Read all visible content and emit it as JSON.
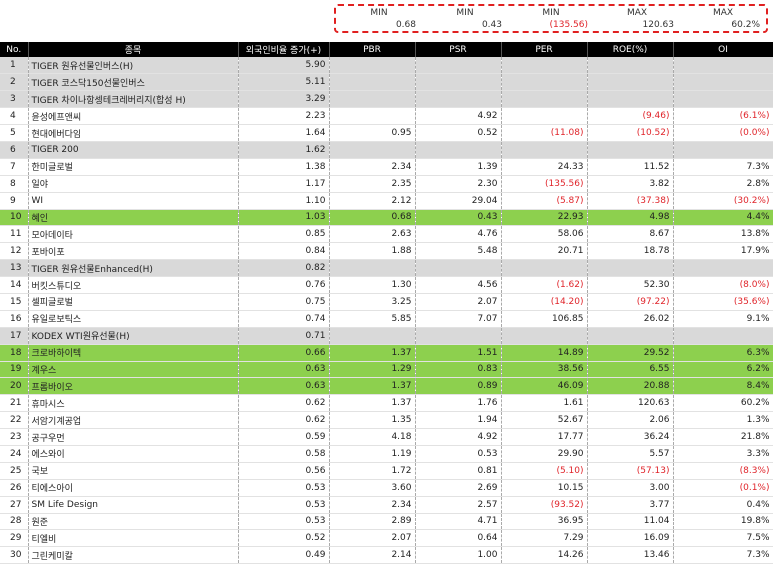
{
  "summary": [
    {
      "label": "MIN",
      "value": "0.68",
      "negative": false
    },
    {
      "label": "MIN",
      "value": "0.43",
      "negative": false
    },
    {
      "label": "MIN",
      "value": "(135.56)",
      "negative": true
    },
    {
      "label": "MAX",
      "value": "120.63",
      "negative": false
    },
    {
      "label": "MAX",
      "value": "60.2%",
      "negative": false
    }
  ],
  "columns": [
    "No.",
    "종목",
    "외국인비율 증가(+)",
    "PBR",
    "PSR",
    "PER",
    "ROE(%)",
    "OI"
  ],
  "rows": [
    {
      "no": "1",
      "name": "TIGER 원유선물인버스(H)",
      "foreign": "5.90",
      "pbr": "",
      "psr": "",
      "per": "",
      "roe": "",
      "oi": "",
      "style": "gray"
    },
    {
      "no": "2",
      "name": "TIGER 코스닥150선물인버스",
      "foreign": "5.11",
      "pbr": "",
      "psr": "",
      "per": "",
      "roe": "",
      "oi": "",
      "style": "gray"
    },
    {
      "no": "3",
      "name": "TIGER 차이나항셍테크레버리지(합성 H)",
      "foreign": "3.29",
      "pbr": "",
      "psr": "",
      "per": "",
      "roe": "",
      "oi": "",
      "style": "gray"
    },
    {
      "no": "4",
      "name": "윤성에프앤씨",
      "foreign": "2.23",
      "pbr": "",
      "psr": "4.92",
      "per": "",
      "roe": "(9.46)",
      "oi": "(6.1%)",
      "style": ""
    },
    {
      "no": "5",
      "name": "현대에버다임",
      "foreign": "1.64",
      "pbr": "0.95",
      "psr": "0.52",
      "per": "(11.08)",
      "roe": "(10.52)",
      "oi": "(0.0%)",
      "style": ""
    },
    {
      "no": "6",
      "name": "TIGER 200",
      "foreign": "1.62",
      "pbr": "",
      "psr": "",
      "per": "",
      "roe": "",
      "oi": "",
      "style": "gray"
    },
    {
      "no": "7",
      "name": "한미글로벌",
      "foreign": "1.38",
      "pbr": "2.34",
      "psr": "1.39",
      "per": "24.33",
      "roe": "11.52",
      "oi": "7.3%",
      "style": ""
    },
    {
      "no": "8",
      "name": "일야",
      "foreign": "1.17",
      "pbr": "2.35",
      "psr": "2.30",
      "per": "(135.56)",
      "roe": "3.82",
      "oi": "2.8%",
      "style": ""
    },
    {
      "no": "9",
      "name": "WI",
      "foreign": "1.10",
      "pbr": "2.12",
      "psr": "29.04",
      "per": "(5.87)",
      "roe": "(37.38)",
      "oi": "(30.2%)",
      "style": ""
    },
    {
      "no": "10",
      "name": "혜인",
      "foreign": "1.03",
      "pbr": "0.68",
      "psr": "0.43",
      "per": "22.93",
      "roe": "4.98",
      "oi": "4.4%",
      "style": "green"
    },
    {
      "no": "11",
      "name": "모아데이타",
      "foreign": "0.85",
      "pbr": "2.63",
      "psr": "4.76",
      "per": "58.06",
      "roe": "8.67",
      "oi": "13.8%",
      "style": ""
    },
    {
      "no": "12",
      "name": "포바이포",
      "foreign": "0.84",
      "pbr": "1.88",
      "psr": "5.48",
      "per": "20.71",
      "roe": "18.78",
      "oi": "17.9%",
      "style": ""
    },
    {
      "no": "13",
      "name": "TIGER 원유선물Enhanced(H)",
      "foreign": "0.82",
      "pbr": "",
      "psr": "",
      "per": "",
      "roe": "",
      "oi": "",
      "style": "gray"
    },
    {
      "no": "14",
      "name": "버킷스튜디오",
      "foreign": "0.76",
      "pbr": "1.30",
      "psr": "4.56",
      "per": "(1.62)",
      "roe": "52.30",
      "oi": "(8.0%)",
      "style": ""
    },
    {
      "no": "15",
      "name": "셀피글로벌",
      "foreign": "0.75",
      "pbr": "3.25",
      "psr": "2.07",
      "per": "(14.20)",
      "roe": "(97.22)",
      "oi": "(35.6%)",
      "style": ""
    },
    {
      "no": "16",
      "name": "유일로보틱스",
      "foreign": "0.74",
      "pbr": "5.85",
      "psr": "7.07",
      "per": "106.85",
      "roe": "26.02",
      "oi": "9.1%",
      "style": ""
    },
    {
      "no": "17",
      "name": "KODEX WTI원유선물(H)",
      "foreign": "0.71",
      "pbr": "",
      "psr": "",
      "per": "",
      "roe": "",
      "oi": "",
      "style": "gray"
    },
    {
      "no": "18",
      "name": "크로바하이텍",
      "foreign": "0.66",
      "pbr": "1.37",
      "psr": "1.51",
      "per": "14.89",
      "roe": "29.52",
      "oi": "6.3%",
      "style": "green"
    },
    {
      "no": "19",
      "name": "계우스",
      "foreign": "0.63",
      "pbr": "1.29",
      "psr": "0.83",
      "per": "38.56",
      "roe": "6.55",
      "oi": "6.2%",
      "style": "green"
    },
    {
      "no": "20",
      "name": "프롬바이오",
      "foreign": "0.63",
      "pbr": "1.37",
      "psr": "0.89",
      "per": "46.09",
      "roe": "20.88",
      "oi": "8.4%",
      "style": "green"
    },
    {
      "no": "21",
      "name": "휴마시스",
      "foreign": "0.62",
      "pbr": "1.37",
      "psr": "1.76",
      "per": "1.61",
      "roe": "120.63",
      "oi": "60.2%",
      "style": ""
    },
    {
      "no": "22",
      "name": "서암기계공업",
      "foreign": "0.62",
      "pbr": "1.35",
      "psr": "1.94",
      "per": "52.67",
      "roe": "2.06",
      "oi": "1.3%",
      "style": ""
    },
    {
      "no": "23",
      "name": "공구우먼",
      "foreign": "0.59",
      "pbr": "4.18",
      "psr": "4.92",
      "per": "17.77",
      "roe": "36.24",
      "oi": "21.8%",
      "style": ""
    },
    {
      "no": "24",
      "name": "에스와이",
      "foreign": "0.58",
      "pbr": "1.19",
      "psr": "0.53",
      "per": "29.90",
      "roe": "5.57",
      "oi": "3.3%",
      "style": ""
    },
    {
      "no": "25",
      "name": "국보",
      "foreign": "0.56",
      "pbr": "1.72",
      "psr": "0.81",
      "per": "(5.10)",
      "roe": "(57.13)",
      "oi": "(8.3%)",
      "style": ""
    },
    {
      "no": "26",
      "name": "티에스아이",
      "foreign": "0.53",
      "pbr": "3.60",
      "psr": "2.69",
      "per": "10.15",
      "roe": "3.00",
      "oi": "(0.1%)",
      "style": ""
    },
    {
      "no": "27",
      "name": "SM Life Design",
      "foreign": "0.53",
      "pbr": "2.34",
      "psr": "2.57",
      "per": "(93.52)",
      "roe": "3.77",
      "oi": "0.4%",
      "style": ""
    },
    {
      "no": "28",
      "name": "원준",
      "foreign": "0.53",
      "pbr": "2.89",
      "psr": "4.71",
      "per": "36.95",
      "roe": "11.04",
      "oi": "19.8%",
      "style": ""
    },
    {
      "no": "29",
      "name": "티엘비",
      "foreign": "0.52",
      "pbr": "2.07",
      "psr": "0.64",
      "per": "7.29",
      "roe": "16.09",
      "oi": "7.5%",
      "style": ""
    },
    {
      "no": "30",
      "name": "그린케미칼",
      "foreign": "0.49",
      "pbr": "2.14",
      "psr": "1.00",
      "per": "14.26",
      "roe": "13.46",
      "oi": "7.3%",
      "style": ""
    }
  ]
}
